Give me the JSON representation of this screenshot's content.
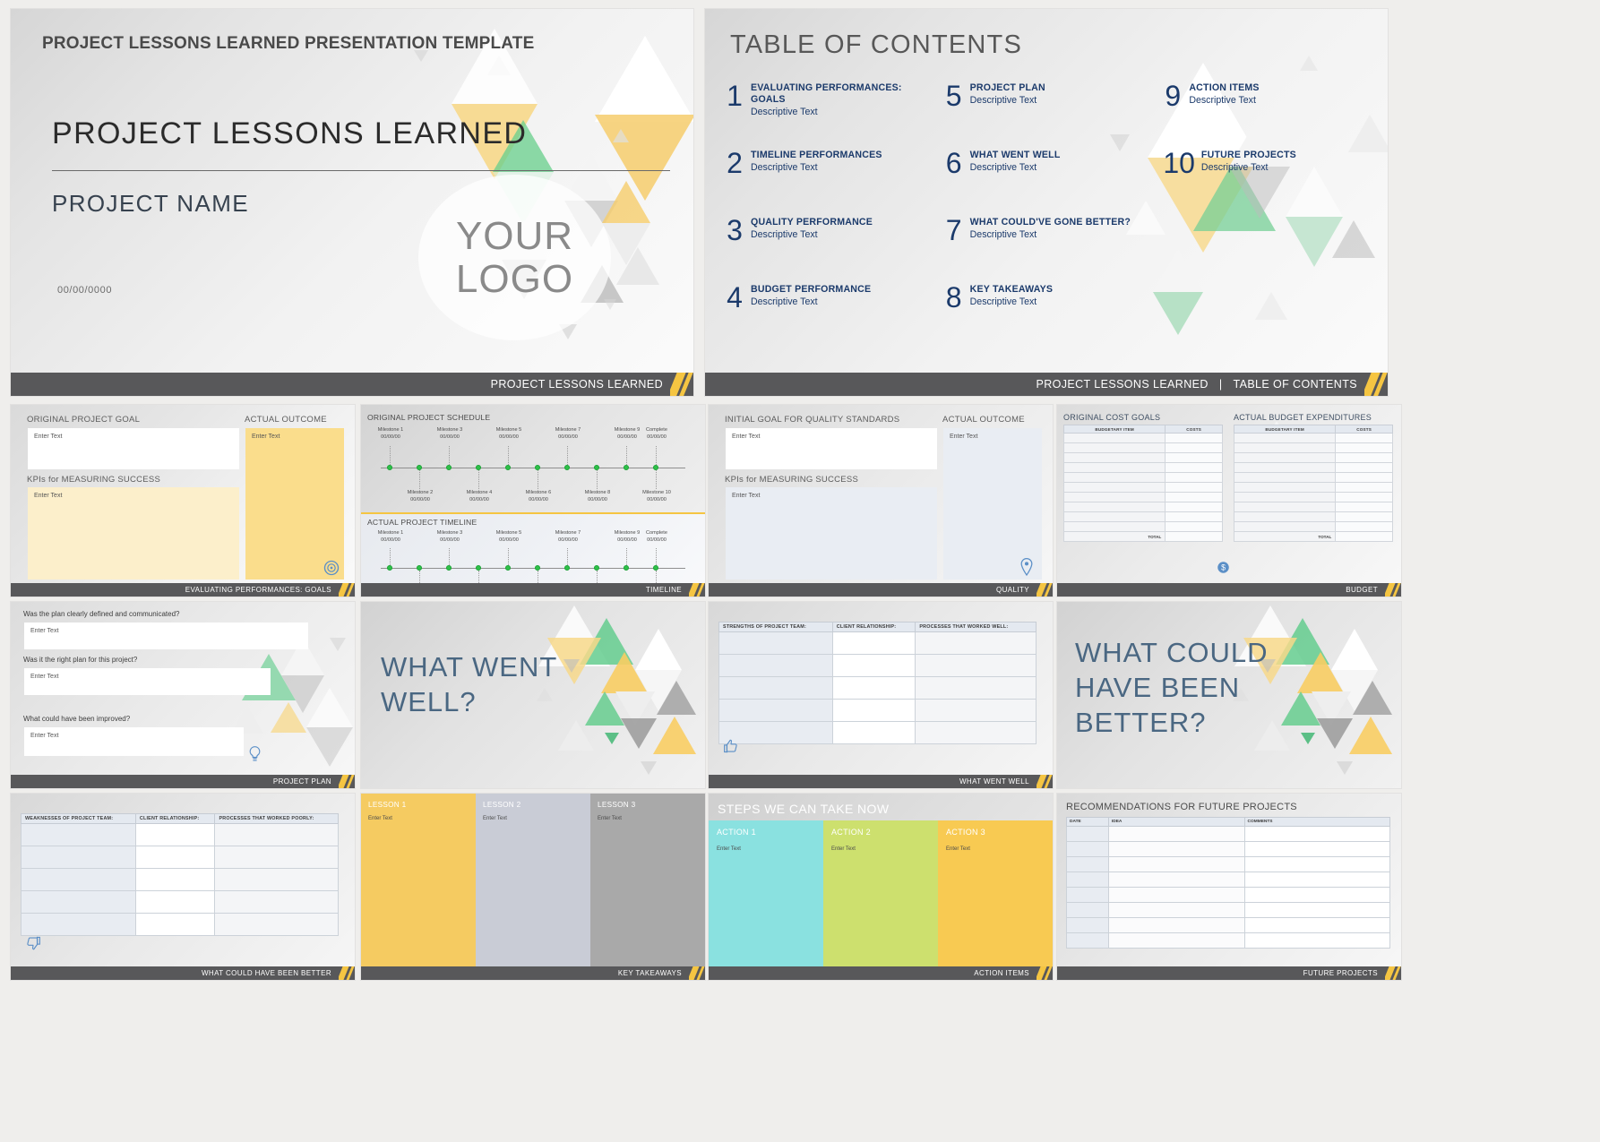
{
  "title_slide": {
    "kicker": "PROJECT LESSONS LEARNED PRESENTATION TEMPLATE",
    "heading": "PROJECT LESSONS LEARNED",
    "subheading": "PROJECT NAME",
    "date": "00/00/0000",
    "logo_line1": "YOUR",
    "logo_line2": "LOGO",
    "footer": "PROJECT LESSONS LEARNED"
  },
  "toc_slide": {
    "heading": "TABLE OF CONTENTS",
    "footer_left": "PROJECT LESSONS LEARNED",
    "footer_sep": "|",
    "footer_right": "TABLE OF CONTENTS",
    "items": [
      {
        "num": "1",
        "title": "EVALUATING PERFORMANCES: GOALS",
        "desc": "Descriptive Text"
      },
      {
        "num": "5",
        "title": "PROJECT PLAN",
        "desc": "Descriptive Text"
      },
      {
        "num": "9",
        "title": "ACTION ITEMS",
        "desc": "Descriptive Text"
      },
      {
        "num": "2",
        "title": "TIMELINE PERFORMANCES",
        "desc": "Descriptive Text"
      },
      {
        "num": "6",
        "title": "WHAT WENT WELL",
        "desc": "Descriptive Text"
      },
      {
        "num": "10",
        "title": "FUTURE PROJECTS",
        "desc": "Descriptive Text"
      },
      {
        "num": "3",
        "title": "QUALITY PERFORMANCE",
        "desc": "Descriptive Text"
      },
      {
        "num": "7",
        "title": "WHAT COULD'VE GONE BETTER?",
        "desc": "Descriptive Text"
      },
      {
        "num": "",
        "title": "",
        "desc": ""
      },
      {
        "num": "4",
        "title": "BUDGET PERFORMANCE",
        "desc": "Descriptive Text"
      },
      {
        "num": "8",
        "title": "KEY TAKEAWAYS",
        "desc": "Descriptive Text"
      },
      {
        "num": "",
        "title": "",
        "desc": ""
      }
    ]
  },
  "goals_slide": {
    "label_goal": "ORIGINAL PROJECT GOAL",
    "label_kpi": "KPIs for MEASURING SUCCESS",
    "label_outcome": "ACTUAL OUTCOME",
    "placeholder": "Enter Text",
    "footer": "EVALUATING PERFORMANCES: GOALS",
    "icon": "target-icon"
  },
  "timeline_slide": {
    "label_original": "ORIGINAL PROJECT SCHEDULE",
    "label_actual": "ACTUAL PROJECT TIMELINE",
    "date_placeholder": "00/00/00",
    "footer": "TIMELINE",
    "milestones_top": [
      "Milestone 1",
      "Milestone 3",
      "Milestone 5",
      "Milestone 7",
      "Milestone 9",
      "Complete"
    ],
    "milestones_bottom": [
      "Milestone 2",
      "Milestone 4",
      "Milestone 6",
      "Milestone 8",
      "Milestone 10"
    ]
  },
  "quality_slide": {
    "label_goal": "INITIAL GOAL FOR QUALITY STANDARDS",
    "label_kpi": "KPIs for MEASURING SUCCESS",
    "label_outcome": "ACTUAL OUTCOME",
    "placeholder": "Enter Text",
    "footer": "QUALITY",
    "icon": "location-pin-icon"
  },
  "budget_slide": {
    "label_left": "ORIGINAL COST GOALS",
    "label_right": "ACTUAL BUDGET EXPENDITURES",
    "col_item": "BUDGETARY ITEM",
    "col_cost": "COSTS",
    "total": "TOTAL",
    "footer": "BUDGET",
    "icon": "money-icon"
  },
  "project_plan_slide": {
    "q1": "Was the plan clearly defined and communicated?",
    "q2": "Was it the right plan for this project?",
    "q3": "What could have been improved?",
    "placeholder": "Enter Text",
    "footer": "PROJECT PLAN",
    "icon": "lightbulb-icon"
  },
  "what_went_well_title_slide": {
    "line1": "WHAT WENT",
    "line2": "WELL?"
  },
  "what_went_well_slide": {
    "columns": [
      "STRENGTHS OF PROJECT TEAM:",
      "CLIENT RELATIONSHIP:",
      "PROCESSES THAT WORKED WELL:"
    ],
    "footer": "WHAT WENT WELL",
    "icon": "thumbs-up-icon",
    "rows": 5
  },
  "what_could_slide": {
    "line1": "WHAT COULD",
    "line2": "HAVE BEEN",
    "line3": "BETTER?"
  },
  "what_could_better_slide": {
    "columns": [
      "WEAKNESSES OF PROJECT TEAM:",
      "CLIENT RELATIONSHIP:",
      "PROCESSES THAT WORKED POORLY:"
    ],
    "footer": "WHAT COULD HAVE BEEN BETTER",
    "icon": "thumbs-down-icon",
    "rows": 5
  },
  "key_takeaways_slide": {
    "lessons": [
      {
        "title": "LESSON 1",
        "placeholder": "Enter Text",
        "color": "#f5cb61"
      },
      {
        "title": "LESSON 2",
        "placeholder": "Enter Text",
        "color": "#c9ccd6"
      },
      {
        "title": "LESSON 3",
        "placeholder": "Enter Text",
        "color": "#a9a9a9"
      }
    ],
    "footer": "KEY TAKEAWAYS"
  },
  "action_items_slide": {
    "heading": "STEPS WE CAN TAKE NOW",
    "actions": [
      {
        "title": "ACTION 1",
        "placeholder": "Enter Text",
        "color": "#8ae1e0"
      },
      {
        "title": "ACTION 2",
        "placeholder": "Enter Text",
        "color": "#cde06e"
      },
      {
        "title": "ACTION 3",
        "placeholder": "Enter Text",
        "color": "#f8ca52"
      }
    ],
    "footer": "ACTION ITEMS"
  },
  "future_projects_slide": {
    "heading": "RECOMMENDATIONS FOR FUTURE PROJECTS",
    "columns": [
      "DATE",
      "IDEA",
      "COMMENTS"
    ],
    "footer": "FUTURE PROJECTS",
    "rows": 8
  },
  "colors": {
    "accent_yellow": "#f5c542",
    "navy": "#1b3a6b",
    "footer_gray": "#58585a",
    "green": "#2fc04a",
    "slide_blue": "#4a6782"
  }
}
